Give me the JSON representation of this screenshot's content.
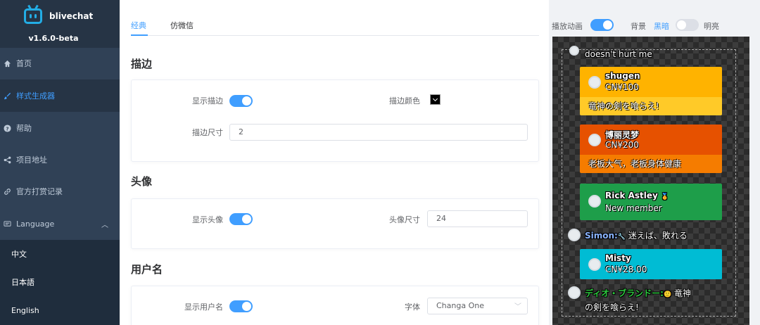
{
  "app": {
    "name": "blivechat",
    "version": "v1.6.0-beta"
  },
  "sidebar": {
    "items": [
      {
        "label": "首页",
        "icon": "home-icon"
      },
      {
        "label": "样式生成器",
        "icon": "brush-icon",
        "active": true
      },
      {
        "label": "帮助",
        "icon": "help-icon"
      },
      {
        "label": "项目地址",
        "icon": "share-icon"
      },
      {
        "label": "官方打赏记录",
        "icon": "link-icon"
      },
      {
        "label": "Language",
        "icon": "language-icon"
      }
    ],
    "languages": [
      "中文",
      "日本語",
      "English"
    ]
  },
  "tabs": [
    {
      "label": "经典",
      "active": true
    },
    {
      "label": "仿微信"
    }
  ],
  "sections": {
    "outline": {
      "title": "描边",
      "show_label": "显示描边",
      "color_label": "描边颜色",
      "size_label": "描边尺寸",
      "size_value": "2"
    },
    "avatar": {
      "title": "头像",
      "show_label": "显示头像",
      "size_label": "头像尺寸",
      "size_value": "24"
    },
    "username": {
      "title": "用户名",
      "show_label": "显示用户名",
      "font_label": "字体",
      "font_value": "Changa One"
    }
  },
  "preview_controls": {
    "animation_label": "播放动画",
    "bg_label": "背景",
    "dark_label": "黑暗",
    "light_label": "明亮"
  },
  "colors": {
    "accent": "#409eff",
    "sidebar_bg": "#304156",
    "card_yellow_head": "#ffb300",
    "card_yellow_body": "#ffca28",
    "card_orange_head": "#e65100",
    "card_orange_body": "#f57c00",
    "card_green": "#1e9e4a",
    "card_cyan": "#00bcd4"
  },
  "preview": {
    "top_text": "doesn't hurt me",
    "cards": [
      {
        "name": "shugen",
        "price": "CN¥100",
        "message": "竜神の剣を喰らえ!"
      },
      {
        "name": "博丽灵梦",
        "price": "CN¥200",
        "message": "老板大气，老板身体健康"
      },
      {
        "name": "Rick Astley",
        "price": "New member"
      },
      {
        "name": "Misty",
        "price": "CN¥28.00"
      }
    ],
    "chat": [
      {
        "name": "Simon:",
        "message": "迷えば、敗れる"
      },
      {
        "name": "ディオ・ブランドー:",
        "message": "竜神",
        "message2": "の剣を喰らえ!"
      }
    ]
  }
}
